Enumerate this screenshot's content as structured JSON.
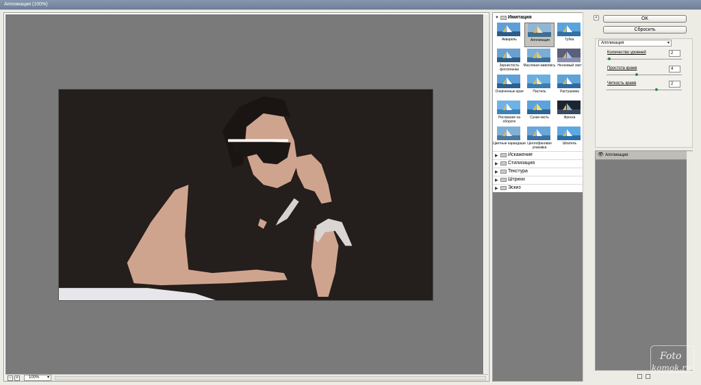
{
  "window": {
    "title": "Аппликация (100%)"
  },
  "preview": {
    "zoom_value": "100%"
  },
  "gallery": {
    "open_category": "Имитация",
    "thumbs": [
      {
        "label": "Акварель"
      },
      {
        "label": "Аппликация",
        "selected": true
      },
      {
        "label": "Губка"
      },
      {
        "label": "Зернистость фотопленки"
      },
      {
        "label": "Масляная живопись"
      },
      {
        "label": "Неоновый свет"
      },
      {
        "label": "Очерченные края"
      },
      {
        "label": "Пастель"
      },
      {
        "label": "Растушевка"
      },
      {
        "label": "Рисование на обороте"
      },
      {
        "label": "Сухая кисть"
      },
      {
        "label": "Фреска"
      },
      {
        "label": "Цветные карандаши"
      },
      {
        "label": "Целлофановая упаковка"
      },
      {
        "label": "Шпатель"
      }
    ],
    "categories": [
      "Искажение",
      "Стилизация",
      "Текстура",
      "Штрихи",
      "Эскиз"
    ]
  },
  "buttons": {
    "ok": "OK",
    "reset": "Сбросить"
  },
  "settings": {
    "filter_select": "Аппликация",
    "params": [
      {
        "label": "Количество уровней",
        "value": "2",
        "level": 0.02
      },
      {
        "label": "Простота краев",
        "value": "4",
        "level": 0.4
      },
      {
        "label": "Четкость краев",
        "value": "2",
        "level": 0.67
      }
    ]
  },
  "layers": {
    "item": "Аппликация"
  },
  "watermark": {
    "line1": "Foto",
    "line2": "komok.ru"
  },
  "colors": {
    "accent_green": "#2e8a4a",
    "preview_bg": "#7a7a7a",
    "image_dark": "#241e1c",
    "skin": "#cfa48e"
  }
}
